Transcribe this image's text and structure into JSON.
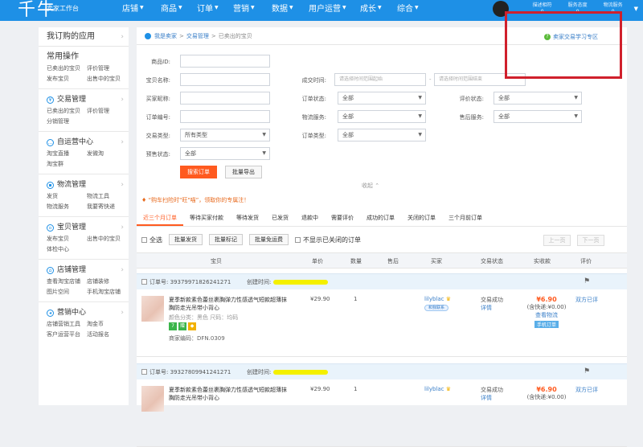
{
  "header": {
    "logo": "千牛",
    "logo_sub": "卖家工作台",
    "nav": [
      "店铺",
      "商品",
      "订单",
      "营销",
      "数据",
      "用户运营",
      "成长",
      "综合"
    ],
    "counters": [
      {
        "label": "描述相符",
        "value": "0"
      },
      {
        "label": "服务态度",
        "value": "0"
      },
      {
        "label": "物流服务",
        "value": "0"
      }
    ]
  },
  "sidebar": {
    "title": "我订购的应用",
    "sections": [
      {
        "title": "常用操作",
        "icon": "",
        "links": [
          "已卖出的宝贝",
          "评价管理",
          "发布宝贝",
          "出售中的宝贝"
        ]
      },
      {
        "title": "交易管理",
        "icon": "trade-icon",
        "links": [
          "已卖出的宝贝",
          "评价管理",
          "分销管理"
        ]
      },
      {
        "title": "自运营中心",
        "icon": "chat-icon",
        "links": [
          "淘宝直播",
          "发微淘",
          "淘宝群"
        ]
      },
      {
        "title": "物流管理",
        "icon": "truck-icon",
        "links": [
          "发货",
          "物流工具",
          "物流服务",
          "我要寄快递"
        ]
      },
      {
        "title": "宝贝管理",
        "icon": "box-icon",
        "links": [
          "发布宝贝",
          "出售中的宝贝",
          "体检中心"
        ]
      },
      {
        "title": "店铺管理",
        "icon": "shop-icon",
        "links": [
          "查看淘宝店铺",
          "店铺装修",
          "图片空间",
          "手机淘宝店铺"
        ]
      },
      {
        "title": "营销中心",
        "icon": "megaphone-icon",
        "links": [
          "店铺营销工具",
          "淘金币",
          "客户运营平台",
          "活动报名"
        ]
      }
    ]
  },
  "breadcrumb": [
    "我是卖家",
    ">",
    "交易管理",
    ">",
    "已卖出的宝贝"
  ],
  "learn_link": "卖家交易学习专区",
  "filters": {
    "product_id": {
      "label": "商品ID:",
      "value": ""
    },
    "product_name": {
      "label": "宝贝名称:",
      "value": ""
    },
    "buyer_nick": {
      "label": "买家昵称:",
      "value": ""
    },
    "order_no": {
      "label": "订单编号:",
      "value": ""
    },
    "trade_type": {
      "label": "交易类型:",
      "value": "所有类型"
    },
    "presale": {
      "label": "预售状态:",
      "value": "全部"
    },
    "deal_time": {
      "label": "成交时间:",
      "start_placeholder": "请选择时间范围起始",
      "end_placeholder": "请选择时间范围结束",
      "sep": "-"
    },
    "order_status": {
      "label": "订单状态:",
      "value": "全部"
    },
    "logistics": {
      "label": "物流服务:",
      "value": "全部"
    },
    "order_type": {
      "label": "订单类型:",
      "value": "全部"
    },
    "review_status": {
      "label": "评价状态:",
      "value": "全部"
    },
    "after_sale": {
      "label": "售后服务:",
      "value": "全部"
    }
  },
  "buttons": {
    "search": "搜索订单",
    "export": "批量导出",
    "collapse": "收起"
  },
  "notice": "“购车扫险时\"旺\"喵”，领取你的专属注！",
  "tabs": [
    "近三个月订单",
    "等待买家付款",
    "等待发货",
    "已发货",
    "退款中",
    "需要评价",
    "成功的订单",
    "关闭的订单",
    "三个月前订单"
  ],
  "actions": {
    "select_all": "全选",
    "batch": [
      "批量发货",
      "批量标记",
      "批量免运费"
    ],
    "hide_closed": "不显示已关闭的订单",
    "prev": "上一页",
    "next": "下一页"
  },
  "table_headers": [
    "宝贝",
    "单价",
    "数量",
    "售后",
    "买家",
    "交易状态",
    "实收款",
    "评价"
  ],
  "orders": [
    {
      "order_no": "订单号: 3937997182624127​1",
      "created": "创建时间:",
      "title": "夏季新款素色蕾丝裹胸弹力性感透气短款超薄抹胸防走光吊带小背心",
      "spec": "颜色分类：黑色  尺码：均码",
      "code": "商家编码：DFN.0309",
      "price": "¥29.90",
      "qty": "1",
      "buyer": "lilyblac",
      "wx": "和我联系",
      "status": "交易成功",
      "detail": "详情",
      "total": "¥6.90",
      "freight": "(含快递:¥0.00)",
      "logistics": "查看物流",
      "tag": "手机订单",
      "review": "双方已评"
    },
    {
      "order_no": "订单号: 393278099412412​71",
      "created": "创建时间:",
      "title": "夏季新款素色蕾丝裹胸弹力性感透气短款超薄抹胸防走光吊带小背心",
      "price": "¥29.90",
      "qty": "1",
      "buyer": "lilyblac",
      "status": "交易成功",
      "detail": "详情",
      "total": "¥6.90",
      "freight": "(含快递:¥0.00)",
      "review": "双方已评"
    }
  ],
  "colors": {
    "topbar": "#1e90e6",
    "accent": "#ff5a1f",
    "highlight_box": "#d0202c",
    "marker": "#f4f000"
  }
}
